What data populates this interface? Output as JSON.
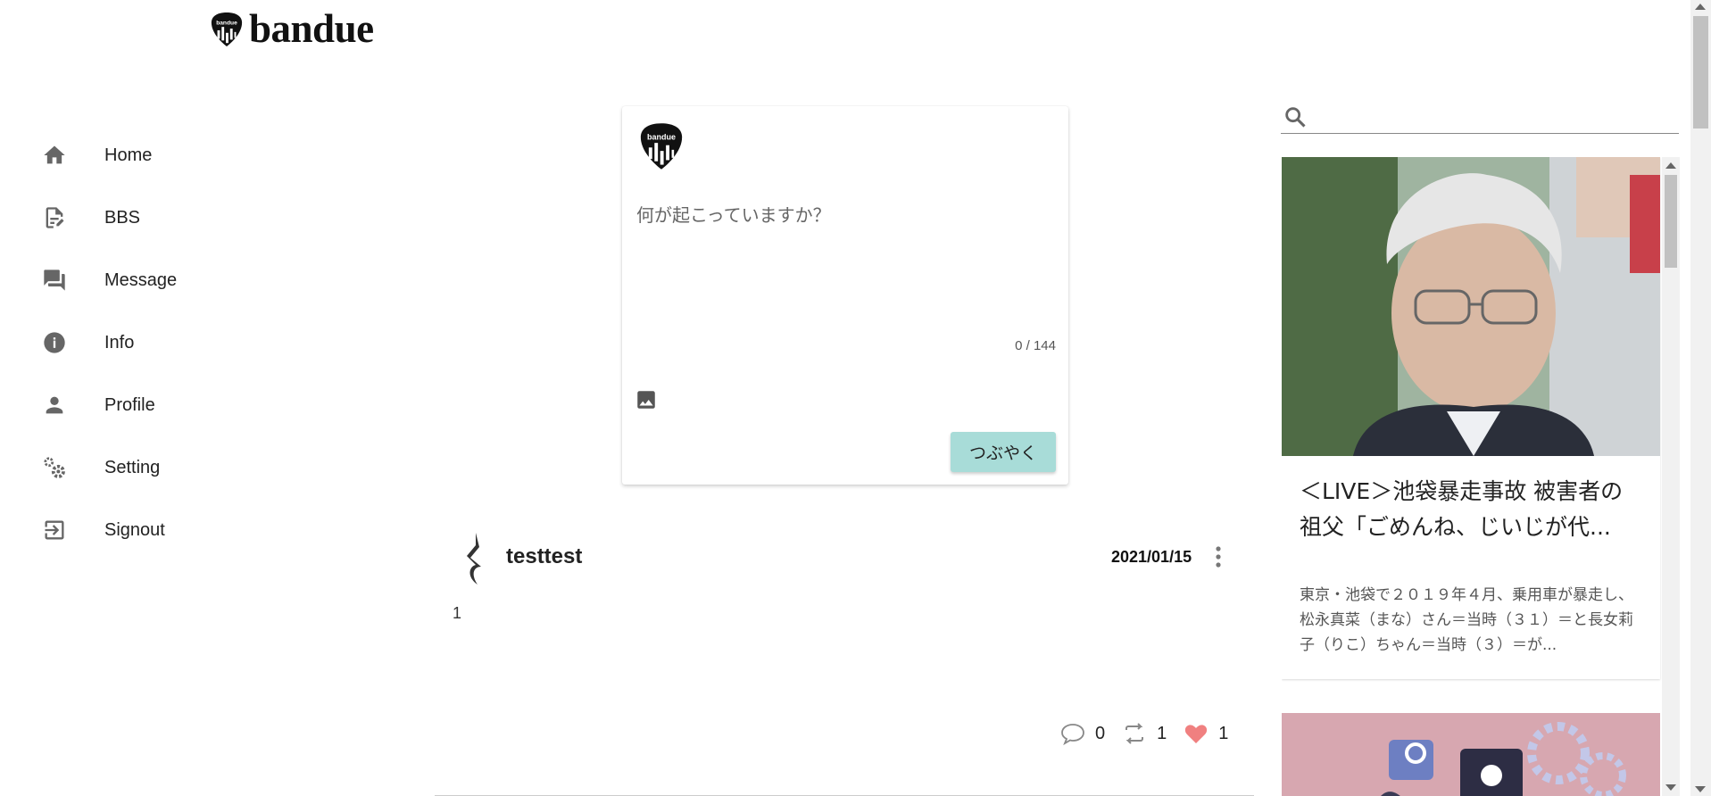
{
  "brand": {
    "name": "bandue",
    "pick_text": "bandue"
  },
  "sidebar": {
    "items": [
      {
        "label": "Home",
        "icon": "home-icon"
      },
      {
        "label": "BBS",
        "icon": "note-edit-icon"
      },
      {
        "label": "Message",
        "icon": "forum-icon"
      },
      {
        "label": "Info",
        "icon": "info-icon"
      },
      {
        "label": "Profile",
        "icon": "person-icon"
      },
      {
        "label": "Setting",
        "icon": "gears-icon"
      },
      {
        "label": "Signout",
        "icon": "exit-icon"
      }
    ]
  },
  "composer": {
    "placeholder": "何が起こっていますか？",
    "counter": "0 / 144",
    "submit_label": "つぶやく",
    "image_icon": "image-icon"
  },
  "post": {
    "author": "testtest",
    "date": "2021/01/15",
    "body": "1",
    "comments": "0",
    "retweets": "1",
    "likes": "1"
  },
  "search": {
    "placeholder": ""
  },
  "news": {
    "items": [
      {
        "title": "＜LIVE＞池袋暴走事故 被害者の祖父「ごめんね、じいじが代...",
        "summary": "東京・池袋で２０１９年４月、乗用車が暴走し、松永真菜（まな）さん＝当時（３１）＝と長女莉子（りこ）ちゃん＝当時（３）＝が..."
      }
    ]
  },
  "colors": {
    "accent_button": "#a8dcd8",
    "like_heart": "#f08080",
    "icon_gray": "#666666"
  }
}
